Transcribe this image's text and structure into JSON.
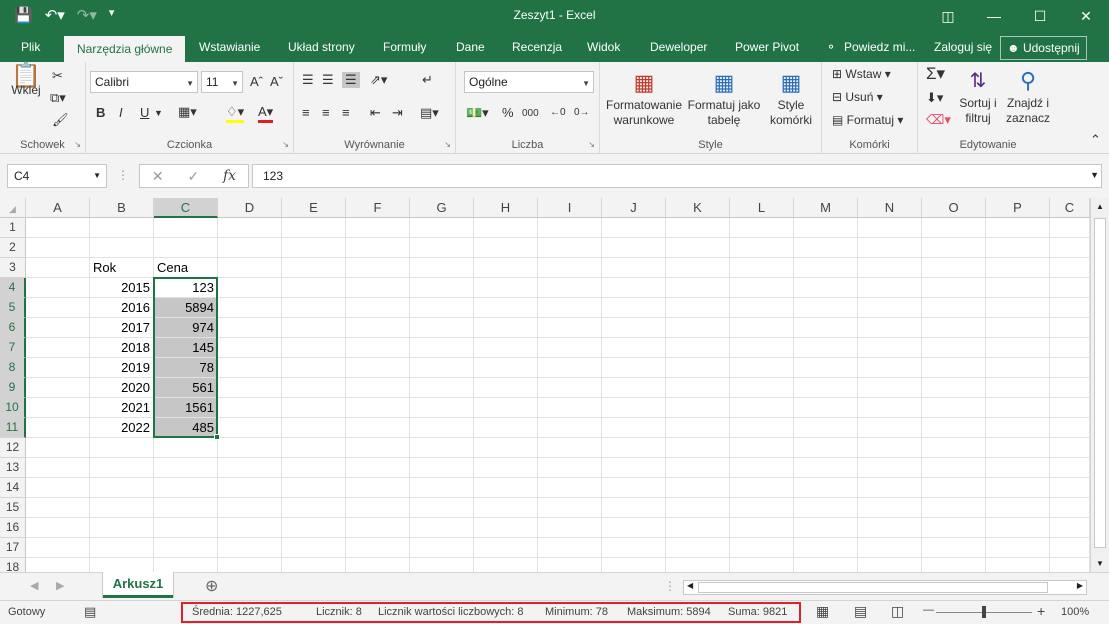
{
  "app": {
    "title": "Zeszyt1 - Excel"
  },
  "ribbon_tabs": {
    "file": "Plik",
    "home": "Narzędzia główne",
    "insert": "Wstawianie",
    "layout": "Układ strony",
    "formulas": "Formuły",
    "data": "Dane",
    "review": "Recenzja",
    "view": "Widok",
    "developer": "Deweloper",
    "powerpivot": "Power Pivot",
    "tell": "Powiedz mi...",
    "login": "Zaloguj się",
    "share": "Udostępnij"
  },
  "clipboard": {
    "paste": "Wklej",
    "label": "Schowek"
  },
  "font": {
    "name": "Calibri",
    "size": "11",
    "bold": "B",
    "italic": "I",
    "underline": "U",
    "label": "Czcionka"
  },
  "alignment": {
    "label": "Wyrównanie"
  },
  "number": {
    "format": "Ogólne",
    "percent": "%",
    "thousands": "000",
    "label": "Liczba"
  },
  "styles": {
    "cond1": "Formatowanie",
    "cond2": "warunkowe",
    "table1": "Formatuj jako",
    "table2": "tabelę",
    "cell1": "Style",
    "cell2": "komórki",
    "label": "Style"
  },
  "cells": {
    "insert": "Wstaw",
    "delete": "Usuń",
    "format": "Formatuj",
    "label": "Komórki"
  },
  "editing": {
    "sort1": "Sortuj i",
    "sort2": "filtruj",
    "find1": "Znajdź i",
    "find2": "zaznacz",
    "label": "Edytowanie"
  },
  "formula_bar": {
    "namebox": "C4",
    "fx": "fx",
    "value": "123"
  },
  "columns": [
    "A",
    "B",
    "C",
    "D",
    "E",
    "F",
    "G",
    "H",
    "I",
    "J",
    "K",
    "L",
    "M",
    "N",
    "O",
    "P",
    "C"
  ],
  "rows": [
    "1",
    "2",
    "3",
    "4",
    "5",
    "6",
    "7",
    "8",
    "9",
    "10",
    "11",
    "12",
    "13",
    "14",
    "15",
    "16",
    "17",
    "18"
  ],
  "table": {
    "header_rok": "Rok",
    "header_cena": "Cena",
    "years": [
      "2015",
      "2016",
      "2017",
      "2018",
      "2019",
      "2020",
      "2021",
      "2022"
    ],
    "prices": [
      "123",
      "5894",
      "974",
      "145",
      "78",
      "561",
      "1561",
      "485"
    ]
  },
  "sheet": {
    "name": "Arkusz1"
  },
  "status": {
    "ready": "Gotowy",
    "avg": "Średnia: 1227,625",
    "count": "Licznik: 8",
    "numcount": "Licznik wartości liczbowych: 8",
    "min": "Minimum: 78",
    "max": "Maksimum: 5894",
    "sum": "Suma: 9821",
    "zoom": "100%"
  },
  "colors": {
    "accent": "#217346",
    "highlight": "#e0202a"
  }
}
